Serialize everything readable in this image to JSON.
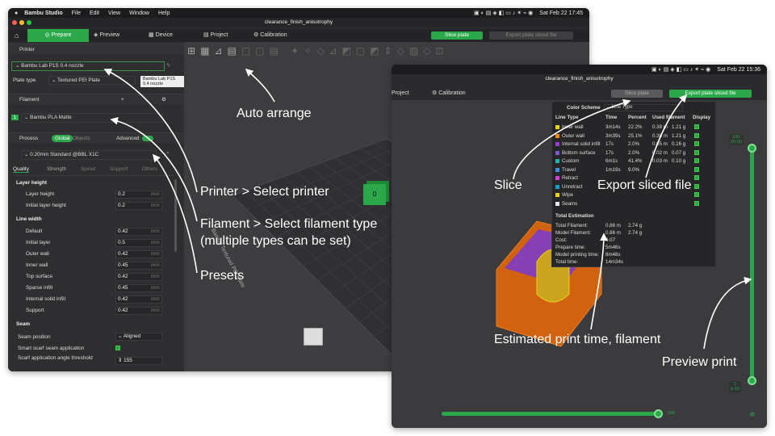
{
  "menubar": {
    "app": "Bambu Studio",
    "items": [
      "File",
      "Edit",
      "View",
      "Window",
      "Help"
    ],
    "clock_left": "Sat Feb 22  17:45",
    "clock_right": "Sat Feb 22  15:36"
  },
  "left_window": {
    "title": "clearance_finish_anisotrophy",
    "tabs": {
      "prepare": "Prepare",
      "preview": "Preview",
      "device": "Device",
      "project": "Project",
      "calibration": "Calibration"
    },
    "slice_button": "Slice plate",
    "export_button": "Export plate sliced file",
    "printer_header": "Printer",
    "printer_value": "Bambu Lab P1S 0.4 nozzle",
    "plate_type_label": "Plate type",
    "plate_type_value": "Textured PEI Plate",
    "tooltip": "Bambu Lab P1S 0.4 nozzle",
    "filament_header": "Filament",
    "filament_index": "1",
    "filament_value": "Bambu PLA Matte",
    "process_header": "Process",
    "process_global": "Global",
    "process_objects": "Objects",
    "advanced_label": "Advanced",
    "process_preset": "0.20mm Standard @BBL X1C",
    "subtabs": [
      "Quality",
      "Strength",
      "Speed",
      "Support",
      "Others"
    ],
    "groups": {
      "layer_height": "Layer height",
      "line_width": "Line width",
      "seam": "Seam"
    },
    "layer_rows": [
      {
        "label": "Layer height",
        "value": "0.2",
        "unit": "mm"
      },
      {
        "label": "Initial layer height",
        "value": "0.2",
        "unit": "mm"
      }
    ],
    "line_rows": [
      {
        "label": "Default",
        "value": "0.42",
        "unit": "mm"
      },
      {
        "label": "Initial layer",
        "value": "0.5",
        "unit": "mm"
      },
      {
        "label": "Outer wall",
        "value": "0.42",
        "unit": "mm"
      },
      {
        "label": "Inner wall",
        "value": "0.45",
        "unit": "mm"
      },
      {
        "label": "Top surface",
        "value": "0.42",
        "unit": "mm"
      },
      {
        "label": "Sparse infill",
        "value": "0.45",
        "unit": "mm"
      },
      {
        "label": "Internal solid infill",
        "value": "0.42",
        "unit": "mm"
      },
      {
        "label": "Support",
        "value": "0.42",
        "unit": "mm"
      }
    ],
    "seam_position_label": "Seam position",
    "seam_position_value": "Aligned",
    "smart_scarf_label": "Smart scarf seam application",
    "scarf_angle_label": "Scarf application angle threshold",
    "scarf_angle_value": "155",
    "plate_text": "Bambu Textured PEI Plate",
    "object_label": "0"
  },
  "right_window": {
    "title": "clearance_finish_anisotrophy",
    "tab_project": "Project",
    "tab_calibration": "Calibration",
    "slice_button": "Slice plate",
    "export_button": "Export plate sliced file",
    "color_scheme_label": "Color Scheme",
    "color_scheme_value": "Line Type",
    "table_headers": [
      "Line Type",
      "Time",
      "Percent",
      "Used filament",
      "Display"
    ],
    "rows": [
      {
        "name": "Inner wall",
        "time": "3m14s",
        "percent": "22.2%",
        "len": "0.38 m",
        "g": "1.21 g",
        "color": "#e8d21c"
      },
      {
        "name": "Outer wall",
        "time": "3m39s",
        "percent": "25.1%",
        "len": "0.38 m",
        "g": "1.21 g",
        "color": "#ef8a1a"
      },
      {
        "name": "Internal solid infill",
        "time": "17s",
        "percent": "2.0%",
        "len": "0.05 m",
        "g": "0.16 g",
        "color": "#9b3bd6"
      },
      {
        "name": "Bottom surface",
        "time": "17s",
        "percent": "2.0%",
        "len": "0.02 m",
        "g": "0.07 g",
        "color": "#7a58d8"
      },
      {
        "name": "Custom",
        "time": "6m1s",
        "percent": "41.4%",
        "len": "0.03 m",
        "g": "0.10 g",
        "color": "#1fb8a8"
      },
      {
        "name": "Travel",
        "time": "1m19s",
        "percent": "9.0%",
        "len": "",
        "g": "",
        "color": "#3c8ee6"
      },
      {
        "name": "Retract",
        "time": "",
        "percent": "",
        "len": "",
        "g": "",
        "color": "#d63cd6"
      },
      {
        "name": "Unretract",
        "time": "",
        "percent": "",
        "len": "",
        "g": "",
        "color": "#19a0c8"
      },
      {
        "name": "Wipe",
        "time": "",
        "percent": "",
        "len": "",
        "g": "",
        "color": "#e8d21c"
      },
      {
        "name": "Seams",
        "time": "",
        "percent": "",
        "len": "",
        "g": "",
        "color": "#e6e6e6"
      }
    ],
    "total_estimation_label": "Total Estimation",
    "estimation": [
      {
        "label": "Total Filament:",
        "a": "0.86 m",
        "b": "2.74 g"
      },
      {
        "label": "Model Filament:",
        "a": "0.86 m",
        "b": "2.74 g"
      },
      {
        "label": "Cost:",
        "a": "0.07",
        "b": ""
      },
      {
        "label": "Prepare time:",
        "a": "5m46s",
        "b": ""
      },
      {
        "label": "Model printing time:",
        "a": "8m48s",
        "b": ""
      },
      {
        "label": "Total time:",
        "a": "14m34s",
        "b": ""
      }
    ],
    "layer_top": "100",
    "layer_top_z": "20.00",
    "layer_bottom": "1",
    "layer_bottom_z": "0.20",
    "horizontal_value": "168"
  },
  "annotations": {
    "auto_arrange": "Auto arrange",
    "printer": "Printer > Select printer",
    "filament_line1": "Filament > Select filament type",
    "filament_line2": "(multiple types can be set)",
    "presets": "Presets",
    "slice": "Slice",
    "export": "Export sliced file",
    "estimated": "Estimated print time, filament",
    "preview": "Preview print"
  },
  "colors": {
    "accent": "#2aa84a",
    "panel": "#2e2e30",
    "viewport": "#3a3a3c"
  }
}
